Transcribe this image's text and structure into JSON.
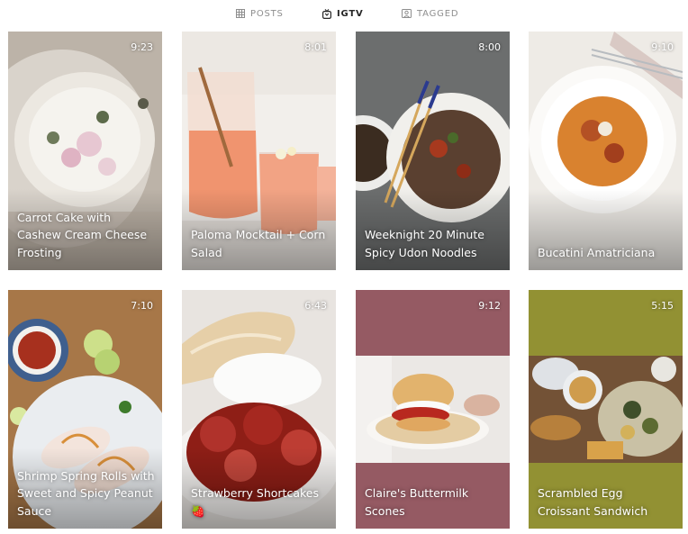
{
  "tabs": {
    "posts": "POSTS",
    "igtv": "IGTV",
    "tagged": "TAGGED"
  },
  "videos": [
    {
      "duration": "9:23",
      "title": "Carrot Cake with Cashew Cream Cheese Frosting"
    },
    {
      "duration": "8:01",
      "title": "Paloma Mocktail + Corn Salad"
    },
    {
      "duration": "8:00",
      "title": "Weeknight 20 Minute Spicy Udon Noodles"
    },
    {
      "duration": "9:10",
      "title": "Bucatini Amatriciana"
    },
    {
      "duration": "7:10",
      "title": "Shrimp Spring Rolls with Sweet and Spicy Peanut Sauce"
    },
    {
      "duration": "6:43",
      "title": "Strawberry Shortcakes 🍓"
    },
    {
      "duration": "9:12",
      "title": "Claire's Buttermilk Scones"
    },
    {
      "duration": "5:15",
      "title": "Scrambled Egg Croissant Sandwich"
    }
  ],
  "colors": {
    "active_tab": "#262626",
    "inactive_tab": "#8e8e8e",
    "claire_band": "#955a63",
    "scrambled_band": "#929133"
  }
}
